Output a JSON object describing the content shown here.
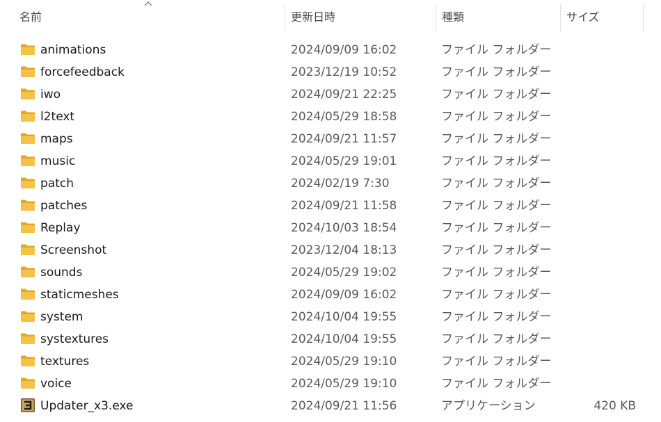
{
  "columns": {
    "name": "名前",
    "date": "更新日時",
    "type": "種類",
    "size": "サイズ"
  },
  "sort": {
    "column": "name",
    "direction": "ascending",
    "icon": "chevron-up-icon"
  },
  "colors": {
    "folder": "#f4c248",
    "folder_dark": "#e2a822",
    "text": "#1a1a1a",
    "muted": "#5a5a5a",
    "separator": "#e3e3e3"
  },
  "files": [
    {
      "name": "animations",
      "date": "2024/09/09 16:02",
      "type": "ファイル フォルダー",
      "size": "",
      "icon": "folder-icon"
    },
    {
      "name": "forcefeedback",
      "date": "2023/12/19 10:52",
      "type": "ファイル フォルダー",
      "size": "",
      "icon": "folder-icon"
    },
    {
      "name": "iwo",
      "date": "2024/09/21 22:25",
      "type": "ファイル フォルダー",
      "size": "",
      "icon": "folder-icon"
    },
    {
      "name": "l2text",
      "date": "2024/05/29 18:58",
      "type": "ファイル フォルダー",
      "size": "",
      "icon": "folder-icon"
    },
    {
      "name": "maps",
      "date": "2024/09/21 11:57",
      "type": "ファイル フォルダー",
      "size": "",
      "icon": "folder-icon"
    },
    {
      "name": "music",
      "date": "2024/05/29 19:01",
      "type": "ファイル フォルダー",
      "size": "",
      "icon": "folder-icon"
    },
    {
      "name": "patch",
      "date": "2024/02/19 7:30",
      "type": "ファイル フォルダー",
      "size": "",
      "icon": "folder-icon"
    },
    {
      "name": "patches",
      "date": "2024/09/21 11:58",
      "type": "ファイル フォルダー",
      "size": "",
      "icon": "folder-icon"
    },
    {
      "name": "Replay",
      "date": "2024/10/03 18:54",
      "type": "ファイル フォルダー",
      "size": "",
      "icon": "folder-icon"
    },
    {
      "name": "Screenshot",
      "date": "2023/12/04 18:13",
      "type": "ファイル フォルダー",
      "size": "",
      "icon": "folder-icon"
    },
    {
      "name": "sounds",
      "date": "2024/05/29 19:02",
      "type": "ファイル フォルダー",
      "size": "",
      "icon": "folder-icon"
    },
    {
      "name": "staticmeshes",
      "date": "2024/09/09 16:02",
      "type": "ファイル フォルダー",
      "size": "",
      "icon": "folder-icon"
    },
    {
      "name": "system",
      "date": "2024/10/04 19:55",
      "type": "ファイル フォルダー",
      "size": "",
      "icon": "folder-icon"
    },
    {
      "name": "systextures",
      "date": "2024/10/04 19:55",
      "type": "ファイル フォルダー",
      "size": "",
      "icon": "folder-icon"
    },
    {
      "name": "textures",
      "date": "2024/05/29 19:10",
      "type": "ファイル フォルダー",
      "size": "",
      "icon": "folder-icon"
    },
    {
      "name": "voice",
      "date": "2024/05/29 19:10",
      "type": "ファイル フォルダー",
      "size": "",
      "icon": "folder-icon"
    },
    {
      "name": "Updater_x3.exe",
      "date": "2024/09/21 11:56",
      "type": "アプリケーション",
      "size": "420 KB",
      "icon": "app-icon"
    }
  ]
}
